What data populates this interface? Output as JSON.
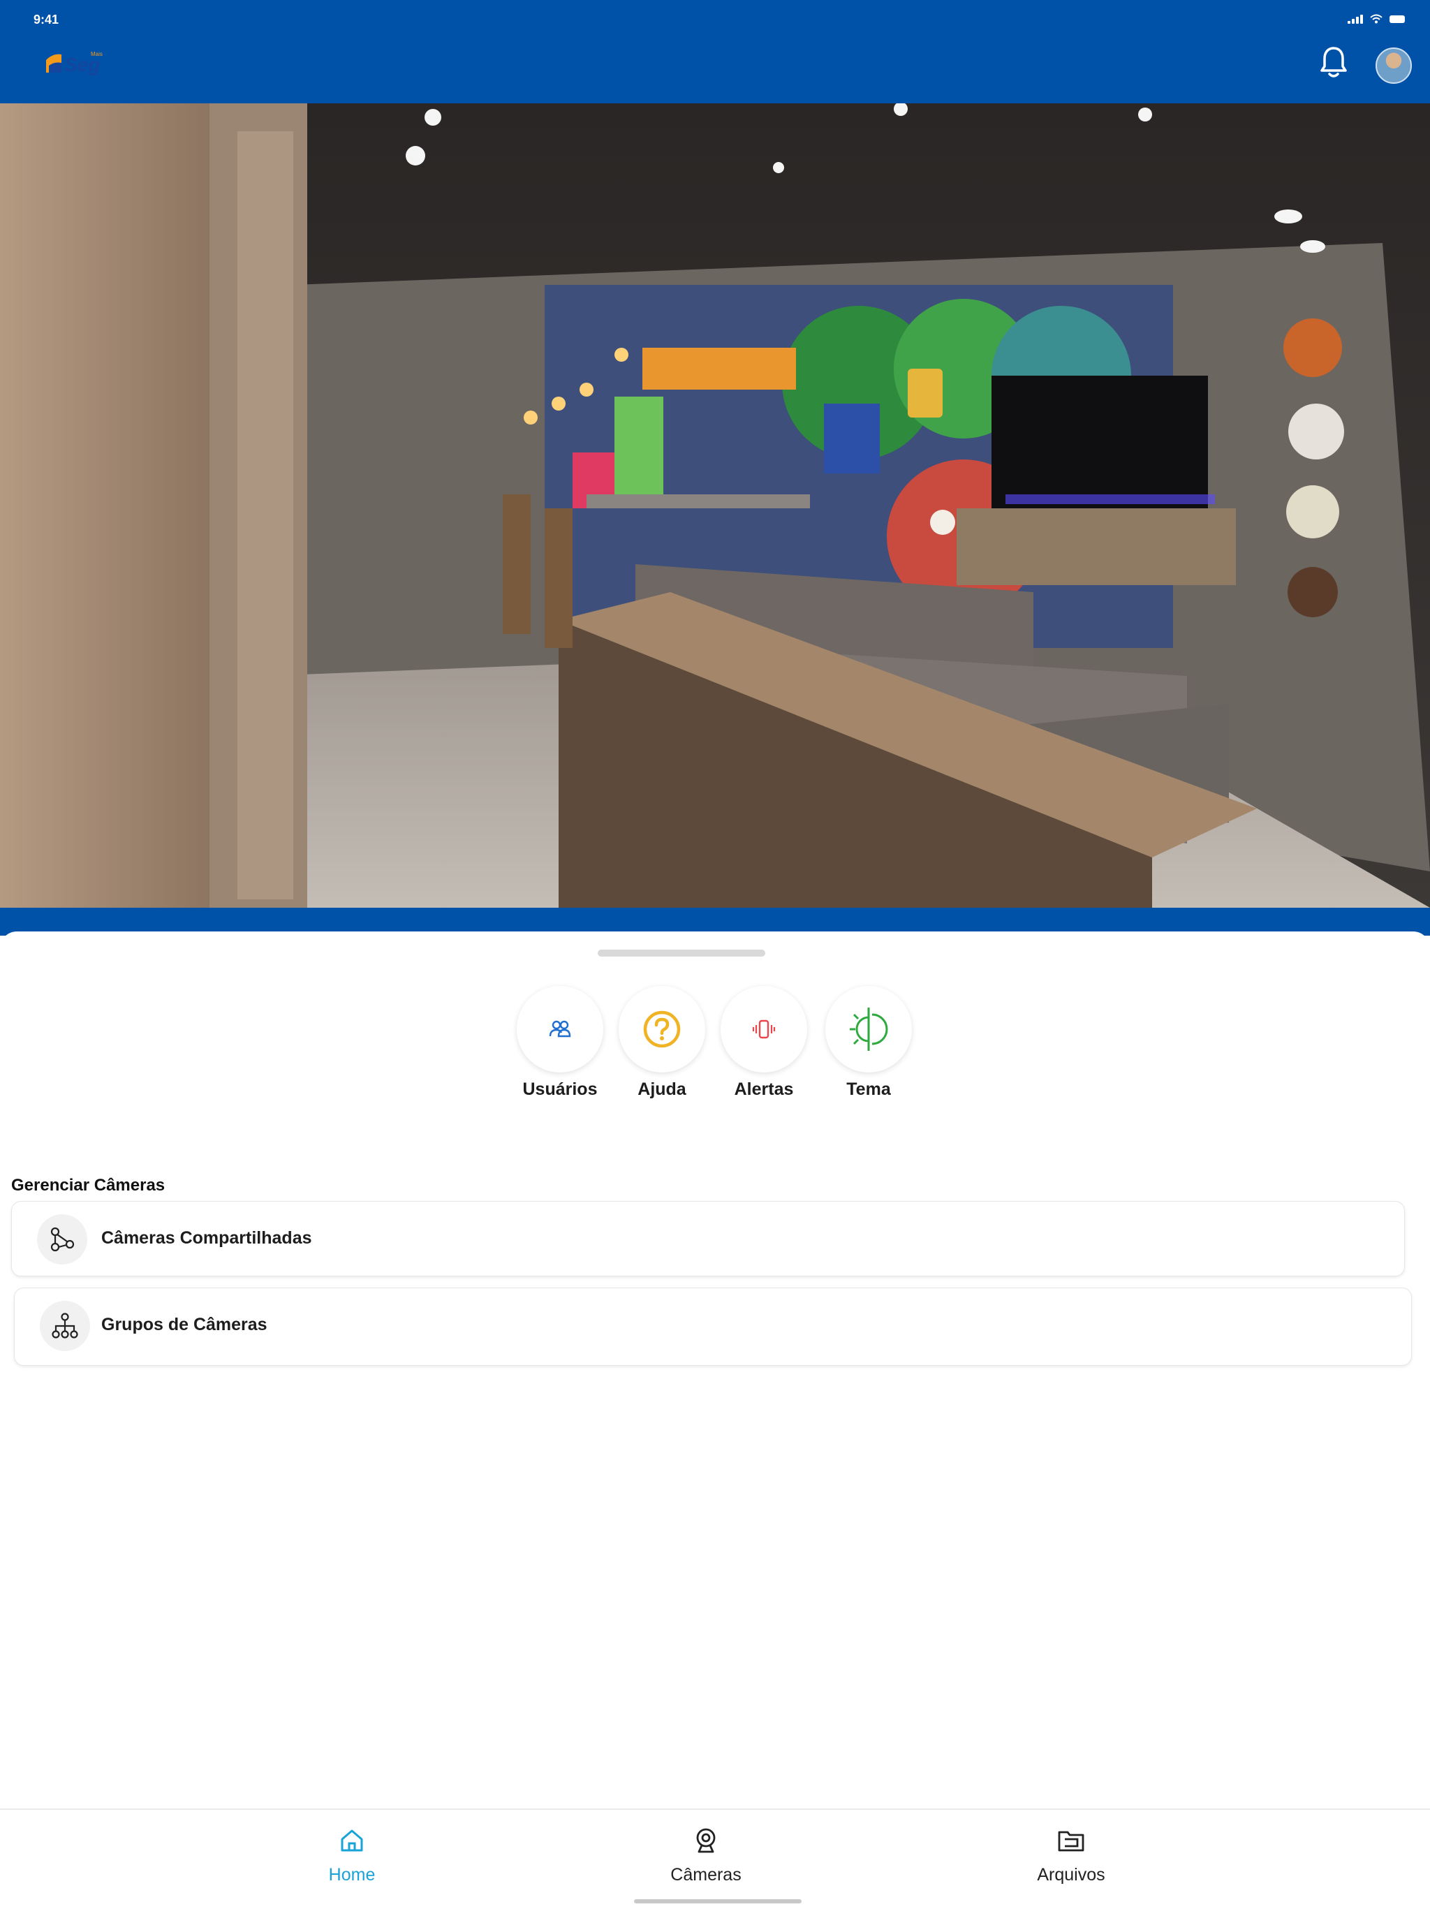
{
  "status_bar": {
    "time": "9:41"
  },
  "header": {
    "logo_text": "Seg",
    "logo_colors": {
      "orange": "#f59a1b",
      "blue": "#1446a0"
    },
    "background": "#0052a8",
    "icons": [
      "bell-icon",
      "avatar"
    ]
  },
  "camera": {
    "description_icon": "camera-feed-image"
  },
  "quick_actions": [
    {
      "label": "Usuários",
      "icon": "users-icon",
      "color": "#1f6fd1"
    },
    {
      "label": "Ajuda",
      "icon": "help-icon",
      "color": "#f0b323"
    },
    {
      "label": "Alertas",
      "icon": "vibrate-alert-icon",
      "color": "#e8474c"
    },
    {
      "label": "Tema",
      "icon": "theme-sun-moon-icon",
      "color": "#2eaa3f"
    }
  ],
  "manage": {
    "title": "Gerenciar Câmeras",
    "items": [
      {
        "label": "Câmeras Compartilhadas",
        "icon": "share-nodes-icon"
      },
      {
        "label": "Grupos de Câmeras",
        "icon": "hierarchy-icon"
      }
    ]
  },
  "tabbar": {
    "items": [
      {
        "label": "Home",
        "icon": "home-icon",
        "active": true
      },
      {
        "label": "Câmeras",
        "icon": "webcam-icon",
        "active": false
      },
      {
        "label": "Arquivos",
        "icon": "folder-icon",
        "active": false
      }
    ],
    "active_color": "#1aa3d9"
  }
}
